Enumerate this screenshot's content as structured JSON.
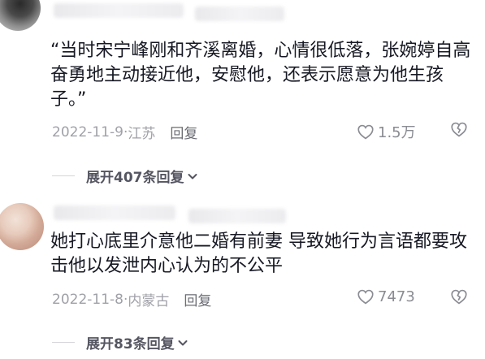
{
  "comments": [
    {
      "text": "“当时宋宁峰刚和齐溪离婚，心情很低落，张婉婷自高奋勇地主动接近他，安慰他，还表示愿意为他生孩子。”",
      "date": "2022-11-9",
      "location": "江苏",
      "reply_label": "回复",
      "likes": "1.5万",
      "expand_label": "展开407条回复"
    },
    {
      "text": "她打心底里介意他二婚有前妻 导致她行为言语都要攻击他以发泄内心认为的不公平",
      "date": "2022-11-8",
      "location": "内蒙古",
      "reply_label": "回复",
      "likes": "7473",
      "expand_label": "展开83条回复"
    }
  ],
  "meta_separator": " · ",
  "icons": {
    "like": "heart-outline-icon",
    "dislike": "broken-heart-icon",
    "expand": "chevron-down-icon"
  },
  "colors": {
    "text": "#161823",
    "meta": "#a0a1a8",
    "expand": "#545561",
    "icon": "#8a8b93"
  }
}
